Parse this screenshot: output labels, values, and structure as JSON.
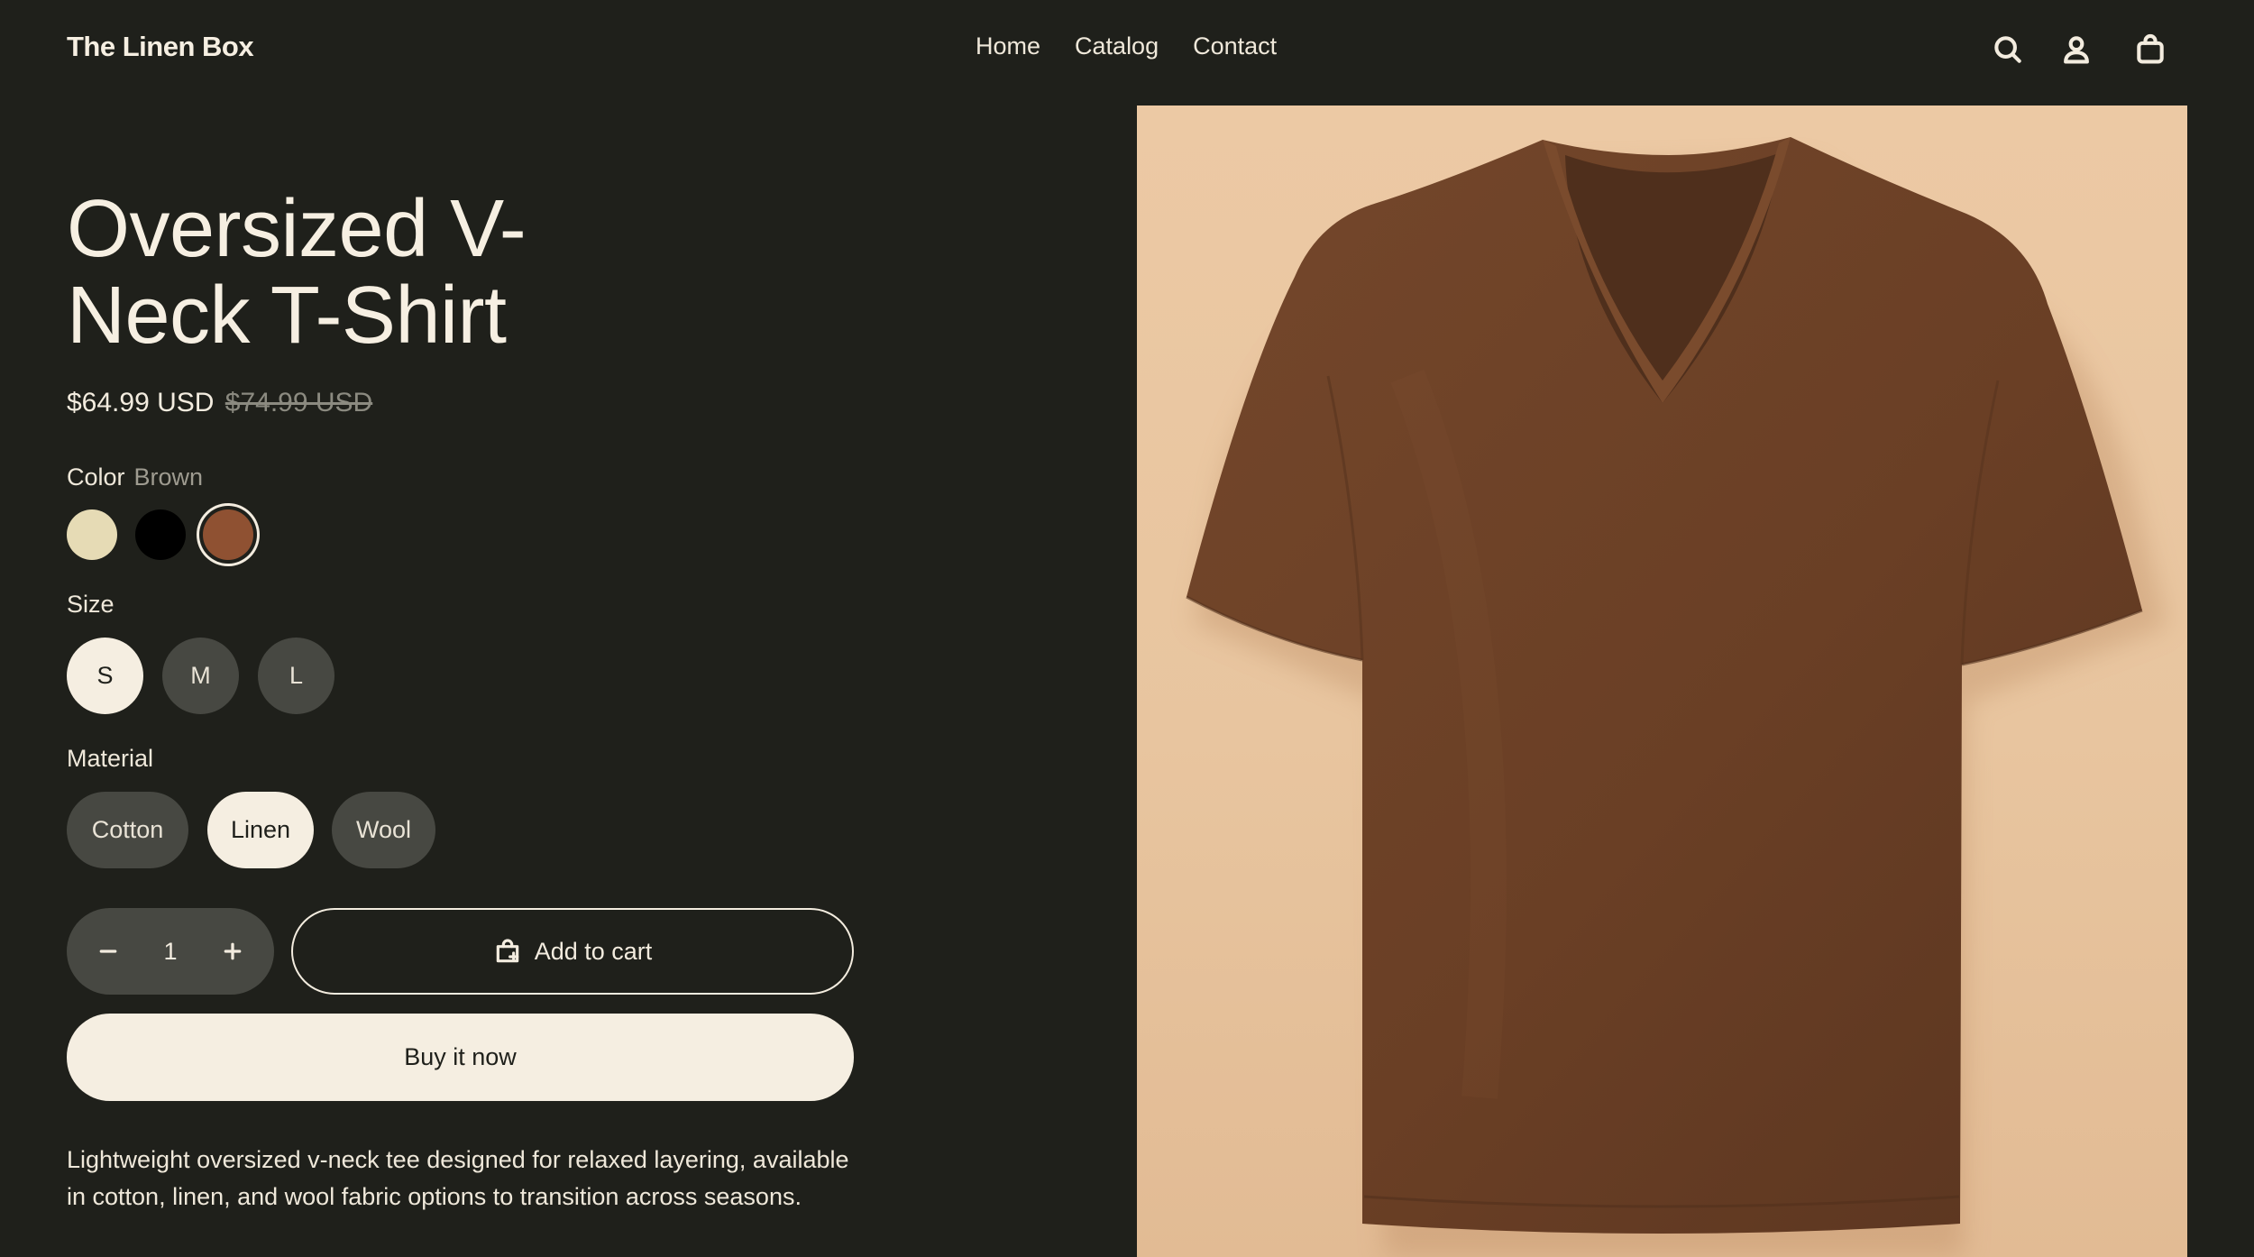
{
  "header": {
    "brand": "The Linen Box",
    "nav": [
      "Home",
      "Catalog",
      "Contact"
    ],
    "icons": [
      "search-icon",
      "account-icon",
      "cart-icon"
    ]
  },
  "product": {
    "title_line1": "Oversized V-",
    "title_line2": "Neck T-Shirt",
    "price": "$64.99 USD",
    "compare_price": "$74.99 USD",
    "color": {
      "label": "Color",
      "selected": "Brown",
      "swatches": [
        {
          "name": "cream",
          "hex": "#e6dbb5"
        },
        {
          "name": "black",
          "hex": "#000000"
        },
        {
          "name": "brown",
          "hex": "#8f5132"
        }
      ]
    },
    "size": {
      "label": "Size",
      "options": [
        "S",
        "M",
        "L"
      ],
      "selected": "S"
    },
    "material": {
      "label": "Material",
      "options": [
        "Cotton",
        "Linen",
        "Wool"
      ],
      "selected": "Linen"
    },
    "quantity": "1",
    "add_to_cart": "Add to cart",
    "buy_now": "Buy it now",
    "description_line1": "Lightweight oversized v-neck tee designed for relaxed layering, available",
    "description_line2": "in cotton, linen, and wool fabric options to transition across seasons."
  },
  "colors": {
    "background": "#1f201b",
    "text": "#f3ecdf",
    "pill": "#474842",
    "pill_selected": "#f5eee1",
    "image_bg": "#ecc9a4",
    "shirt": "#6b4026"
  }
}
